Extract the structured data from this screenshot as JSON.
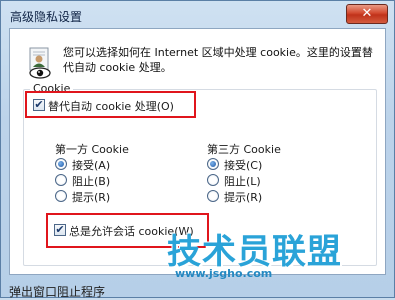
{
  "window": {
    "title": "高级隐私设置",
    "close_glyph": "✕"
  },
  "intro": {
    "text": "您可以选择如何在 Internet 区域中处理 cookie。这里的设置替代自动 cookie 处理。"
  },
  "cookie_group": {
    "legend": "Cookie",
    "override_checkbox": {
      "label": "替代自动 cookie 处理(O)",
      "checked": true
    }
  },
  "first_party": {
    "heading": "第一方 Cookie",
    "options": [
      {
        "label": "接受(A)",
        "selected": true
      },
      {
        "label": "阻止(B)",
        "selected": false
      },
      {
        "label": "提示(R)",
        "selected": false
      }
    ]
  },
  "third_party": {
    "heading": "第三方 Cookie",
    "options": [
      {
        "label": "接受(C)",
        "selected": true
      },
      {
        "label": "阻止(L)",
        "selected": false
      },
      {
        "label": "提示(R)",
        "selected": false
      }
    ]
  },
  "session_checkbox": {
    "label": "总是允许会话 cookie(W)",
    "checked": true
  },
  "check_glyph": "✔",
  "watermark": {
    "main": "技术员联盟",
    "url": "www.jsgho.com"
  },
  "behind_window_text": "弹出窗口阻止程序",
  "colors": {
    "highlight": "#e0151c",
    "accent": "#2aa3d8"
  }
}
